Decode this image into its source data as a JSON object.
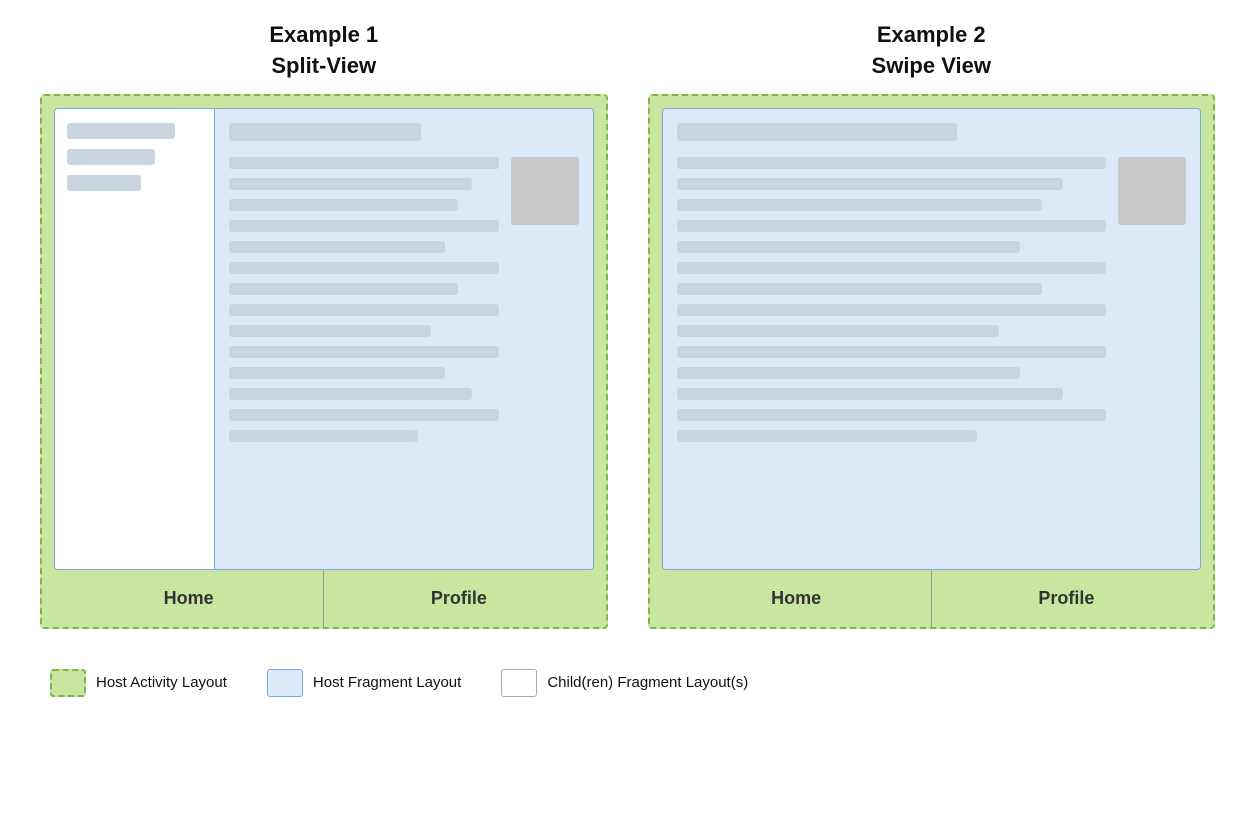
{
  "example1": {
    "title_line1": "Example 1",
    "title_line2": "Split-View"
  },
  "example2": {
    "title_line1": "Example 2",
    "title_line2": "Swipe View"
  },
  "nav": {
    "home": "Home",
    "profile": "Profile"
  },
  "swipe": {
    "arrow_left": "‹",
    "arrow_right": "›"
  },
  "legend": {
    "item1_label": "Host Activity Layout",
    "item2_label": "Host Fragment Layout",
    "item3_label": "Child(ren) Fragment Layout(s)"
  }
}
